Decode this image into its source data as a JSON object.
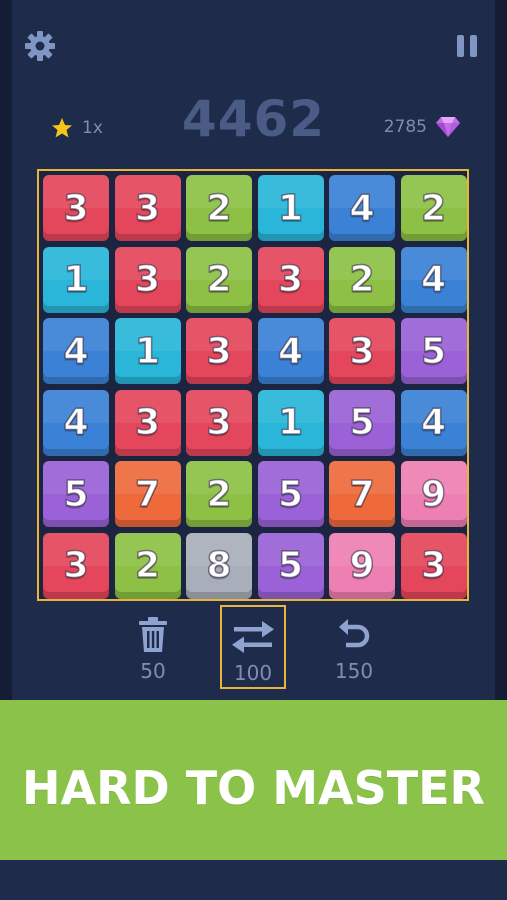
{
  "score": "4462",
  "stars": {
    "multiplier": "1x",
    "icon": "star-icon"
  },
  "gems": {
    "count": "2785",
    "icon": "diamond-icon"
  },
  "top_bar": {
    "settings_icon": "gear-icon",
    "pause_icon": "pause-icon"
  },
  "tile_colors": {
    "1": "#29b6d8",
    "2": "#8dc044",
    "3": "#e4465b",
    "4": "#3b82d6",
    "5": "#9a62d6",
    "7": "#ee6a3b",
    "8": "#a9afba",
    "9": "#ee7fb2"
  },
  "board": [
    [
      "3",
      "3",
      "2",
      "1",
      "4",
      "2"
    ],
    [
      "1",
      "3",
      "2",
      "3",
      "2",
      "4"
    ],
    [
      "4",
      "1",
      "3",
      "4",
      "3",
      "5"
    ],
    [
      "4",
      "3",
      "3",
      "1",
      "5",
      "4"
    ],
    [
      "5",
      "7",
      "2",
      "5",
      "7",
      "9"
    ],
    [
      "3",
      "2",
      "8",
      "5",
      "9",
      "3"
    ]
  ],
  "tools": {
    "trash": {
      "cost": "50",
      "icon": "trash-icon"
    },
    "swap": {
      "cost": "100",
      "icon": "swap-arrows-icon",
      "selected": true
    },
    "undo": {
      "cost": "150",
      "icon": "undo-icon"
    }
  },
  "banner": {
    "text": "HARD TO MASTER"
  },
  "colors": {
    "accent": "#e8b53c",
    "banner": "#8bc34a",
    "background": "#1f2b4a"
  }
}
